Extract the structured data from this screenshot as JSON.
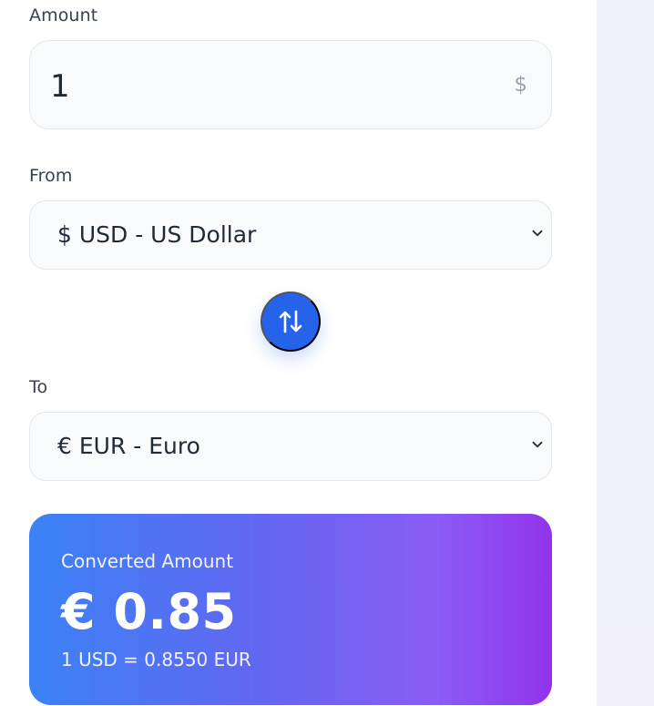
{
  "form": {
    "amount": {
      "label": "Amount",
      "value": "1",
      "currency_symbol": "$"
    },
    "from": {
      "label": "From",
      "selected": "$ USD - US Dollar"
    },
    "to": {
      "label": "To",
      "selected": "€ EUR - Euro"
    },
    "swap_icon": "swap-vertical-icon"
  },
  "result": {
    "label": "Converted Amount",
    "value": "€ 0.85",
    "rate": "1 USD = 0.8550 EUR"
  },
  "colors": {
    "accent": "#2563eb",
    "gradient_start": "#3b82f6",
    "gradient_end": "#9333ea",
    "input_background": "#f8fafc",
    "panel_background": "#eef0fb"
  }
}
